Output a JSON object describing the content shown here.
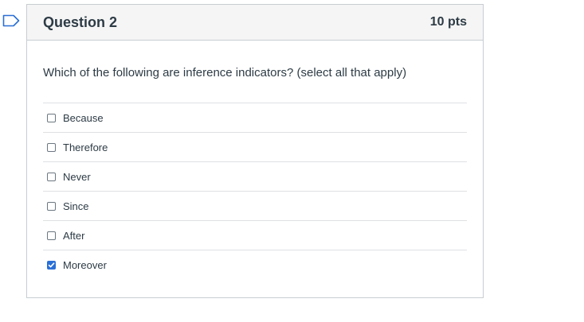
{
  "question": {
    "title": "Question 2",
    "points": "10 pts",
    "text": "Which of the following are inference indicators? (select all that apply)",
    "answers": [
      {
        "label": "Because",
        "checked": false
      },
      {
        "label": "Therefore",
        "checked": false
      },
      {
        "label": "Never",
        "checked": false
      },
      {
        "label": "Since",
        "checked": false
      },
      {
        "label": "After",
        "checked": false
      },
      {
        "label": "Moreover",
        "checked": true
      }
    ]
  },
  "colors": {
    "accent": "#2a6fd6",
    "flag": "#2a6fd6",
    "header_bg": "#f5f5f5",
    "border": "#c7cdd1",
    "text": "#2d3b45"
  },
  "icons": {
    "flag": "flag-question-icon",
    "checkmark": "checkmark-icon"
  }
}
